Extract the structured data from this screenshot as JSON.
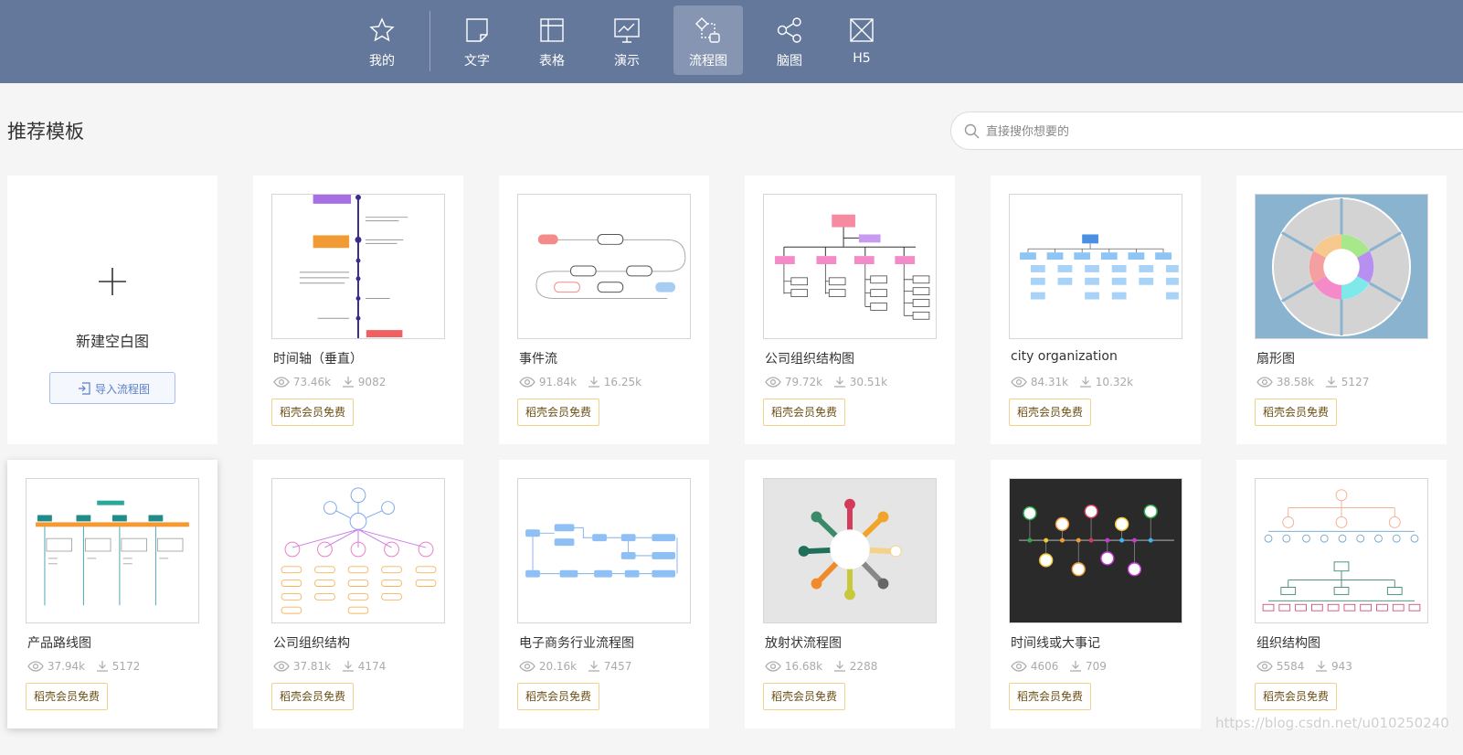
{
  "nav": {
    "items": [
      {
        "label": "我的",
        "icon": "star-icon"
      },
      {
        "label": "文字",
        "icon": "document-icon"
      },
      {
        "label": "表格",
        "icon": "table-icon"
      },
      {
        "label": "演示",
        "icon": "presentation-icon"
      },
      {
        "label": "流程图",
        "icon": "flowchart-icon",
        "active": true
      },
      {
        "label": "脑图",
        "icon": "mindmap-icon"
      },
      {
        "label": "H5",
        "icon": "h5-icon"
      }
    ]
  },
  "header": {
    "title": "推荐模板",
    "search_placeholder": "直接搜你想要的"
  },
  "new_card": {
    "label": "新建空白图",
    "import_label": "导入流程图"
  },
  "templates": [
    {
      "title": "时间轴（垂直）",
      "views": "73.46k",
      "downloads": "9082",
      "badge": "稻壳会员免费"
    },
    {
      "title": "事件流",
      "views": "91.84k",
      "downloads": "16.25k",
      "badge": "稻壳会员免费"
    },
    {
      "title": "公司组织结构图",
      "views": "79.72k",
      "downloads": "30.51k",
      "badge": "稻壳会员免费"
    },
    {
      "title": "city organization",
      "views": "84.31k",
      "downloads": "10.32k",
      "badge": "稻壳会员免费"
    },
    {
      "title": "扇形图",
      "views": "38.58k",
      "downloads": "5127",
      "badge": "稻壳会员免费"
    },
    {
      "title": "产品路线图",
      "views": "37.94k",
      "downloads": "5172",
      "badge": "稻壳会员免费"
    },
    {
      "title": "公司组织结构",
      "views": "37.81k",
      "downloads": "4174",
      "badge": "稻壳会员免费"
    },
    {
      "title": "电子商务行业流程图",
      "views": "20.16k",
      "downloads": "7457",
      "badge": "稻壳会员免费"
    },
    {
      "title": "放射状流程图",
      "views": "16.68k",
      "downloads": "2288",
      "badge": "稻壳会员免费"
    },
    {
      "title": "时间线或大事记",
      "views": "4606",
      "downloads": "709",
      "badge": "稻壳会员免费"
    },
    {
      "title": "组织结构图",
      "views": "5584",
      "downloads": "943",
      "badge": "稻壳会员免费"
    }
  ],
  "watermark": "https://blog.csdn.net/u010250240",
  "colors": {
    "topbar": "#64789b",
    "badge_border": "#f2d28a",
    "import_border": "#a9bfe8"
  }
}
